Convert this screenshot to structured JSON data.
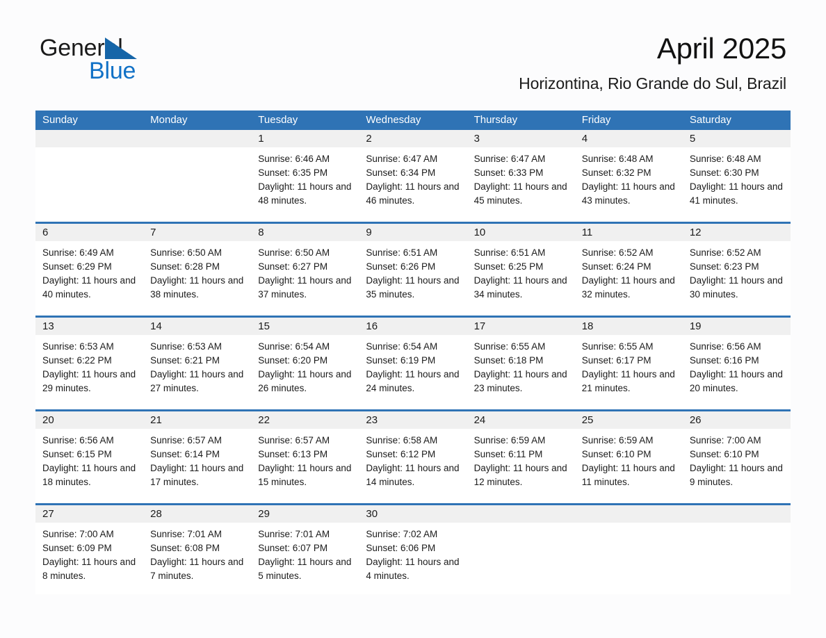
{
  "brand": {
    "name_part1": "General",
    "name_part2": "Blue",
    "triangle_icon": "brand-triangle-icon",
    "colors": {
      "blue": "#1171c6",
      "triangle_blue": "#1565a8",
      "black": "#1a1a1a"
    }
  },
  "header": {
    "month_title": "April 2025",
    "location": "Horizontina, Rio Grande do Sul, Brazil"
  },
  "theme": {
    "header_blue": "#2f73b5",
    "daynum_gray": "#f0f0f0",
    "page_background": "#fcfcfd",
    "text": "#1b1b1b"
  },
  "calendar": {
    "weekdays": [
      "Sunday",
      "Monday",
      "Tuesday",
      "Wednesday",
      "Thursday",
      "Friday",
      "Saturday"
    ],
    "weeks": [
      [
        {
          "day": "",
          "empty": true
        },
        {
          "day": "",
          "empty": true
        },
        {
          "day": "1",
          "sunrise": "Sunrise: 6:46 AM",
          "sunset": "Sunset: 6:35 PM",
          "daylight": "Daylight: 11 hours and 48 minutes."
        },
        {
          "day": "2",
          "sunrise": "Sunrise: 6:47 AM",
          "sunset": "Sunset: 6:34 PM",
          "daylight": "Daylight: 11 hours and 46 minutes."
        },
        {
          "day": "3",
          "sunrise": "Sunrise: 6:47 AM",
          "sunset": "Sunset: 6:33 PM",
          "daylight": "Daylight: 11 hours and 45 minutes."
        },
        {
          "day": "4",
          "sunrise": "Sunrise: 6:48 AM",
          "sunset": "Sunset: 6:32 PM",
          "daylight": "Daylight: 11 hours and 43 minutes."
        },
        {
          "day": "5",
          "sunrise": "Sunrise: 6:48 AM",
          "sunset": "Sunset: 6:30 PM",
          "daylight": "Daylight: 11 hours and 41 minutes."
        }
      ],
      [
        {
          "day": "6",
          "sunrise": "Sunrise: 6:49 AM",
          "sunset": "Sunset: 6:29 PM",
          "daylight": "Daylight: 11 hours and 40 minutes."
        },
        {
          "day": "7",
          "sunrise": "Sunrise: 6:50 AM",
          "sunset": "Sunset: 6:28 PM",
          "daylight": "Daylight: 11 hours and 38 minutes."
        },
        {
          "day": "8",
          "sunrise": "Sunrise: 6:50 AM",
          "sunset": "Sunset: 6:27 PM",
          "daylight": "Daylight: 11 hours and 37 minutes."
        },
        {
          "day": "9",
          "sunrise": "Sunrise: 6:51 AM",
          "sunset": "Sunset: 6:26 PM",
          "daylight": "Daylight: 11 hours and 35 minutes."
        },
        {
          "day": "10",
          "sunrise": "Sunrise: 6:51 AM",
          "sunset": "Sunset: 6:25 PM",
          "daylight": "Daylight: 11 hours and 34 minutes."
        },
        {
          "day": "11",
          "sunrise": "Sunrise: 6:52 AM",
          "sunset": "Sunset: 6:24 PM",
          "daylight": "Daylight: 11 hours and 32 minutes."
        },
        {
          "day": "12",
          "sunrise": "Sunrise: 6:52 AM",
          "sunset": "Sunset: 6:23 PM",
          "daylight": "Daylight: 11 hours and 30 minutes."
        }
      ],
      [
        {
          "day": "13",
          "sunrise": "Sunrise: 6:53 AM",
          "sunset": "Sunset: 6:22 PM",
          "daylight": "Daylight: 11 hours and 29 minutes."
        },
        {
          "day": "14",
          "sunrise": "Sunrise: 6:53 AM",
          "sunset": "Sunset: 6:21 PM",
          "daylight": "Daylight: 11 hours and 27 minutes."
        },
        {
          "day": "15",
          "sunrise": "Sunrise: 6:54 AM",
          "sunset": "Sunset: 6:20 PM",
          "daylight": "Daylight: 11 hours and 26 minutes."
        },
        {
          "day": "16",
          "sunrise": "Sunrise: 6:54 AM",
          "sunset": "Sunset: 6:19 PM",
          "daylight": "Daylight: 11 hours and 24 minutes."
        },
        {
          "day": "17",
          "sunrise": "Sunrise: 6:55 AM",
          "sunset": "Sunset: 6:18 PM",
          "daylight": "Daylight: 11 hours and 23 minutes."
        },
        {
          "day": "18",
          "sunrise": "Sunrise: 6:55 AM",
          "sunset": "Sunset: 6:17 PM",
          "daylight": "Daylight: 11 hours and 21 minutes."
        },
        {
          "day": "19",
          "sunrise": "Sunrise: 6:56 AM",
          "sunset": "Sunset: 6:16 PM",
          "daylight": "Daylight: 11 hours and 20 minutes."
        }
      ],
      [
        {
          "day": "20",
          "sunrise": "Sunrise: 6:56 AM",
          "sunset": "Sunset: 6:15 PM",
          "daylight": "Daylight: 11 hours and 18 minutes."
        },
        {
          "day": "21",
          "sunrise": "Sunrise: 6:57 AM",
          "sunset": "Sunset: 6:14 PM",
          "daylight": "Daylight: 11 hours and 17 minutes."
        },
        {
          "day": "22",
          "sunrise": "Sunrise: 6:57 AM",
          "sunset": "Sunset: 6:13 PM",
          "daylight": "Daylight: 11 hours and 15 minutes."
        },
        {
          "day": "23",
          "sunrise": "Sunrise: 6:58 AM",
          "sunset": "Sunset: 6:12 PM",
          "daylight": "Daylight: 11 hours and 14 minutes."
        },
        {
          "day": "24",
          "sunrise": "Sunrise: 6:59 AM",
          "sunset": "Sunset: 6:11 PM",
          "daylight": "Daylight: 11 hours and 12 minutes."
        },
        {
          "day": "25",
          "sunrise": "Sunrise: 6:59 AM",
          "sunset": "Sunset: 6:10 PM",
          "daylight": "Daylight: 11 hours and 11 minutes."
        },
        {
          "day": "26",
          "sunrise": "Sunrise: 7:00 AM",
          "sunset": "Sunset: 6:10 PM",
          "daylight": "Daylight: 11 hours and 9 minutes."
        }
      ],
      [
        {
          "day": "27",
          "sunrise": "Sunrise: 7:00 AM",
          "sunset": "Sunset: 6:09 PM",
          "daylight": "Daylight: 11 hours and 8 minutes."
        },
        {
          "day": "28",
          "sunrise": "Sunrise: 7:01 AM",
          "sunset": "Sunset: 6:08 PM",
          "daylight": "Daylight: 11 hours and 7 minutes."
        },
        {
          "day": "29",
          "sunrise": "Sunrise: 7:01 AM",
          "sunset": "Sunset: 6:07 PM",
          "daylight": "Daylight: 11 hours and 5 minutes."
        },
        {
          "day": "30",
          "sunrise": "Sunrise: 7:02 AM",
          "sunset": "Sunset: 6:06 PM",
          "daylight": "Daylight: 11 hours and 4 minutes."
        },
        {
          "day": "",
          "empty": true
        },
        {
          "day": "",
          "empty": true
        },
        {
          "day": "",
          "empty": true
        }
      ]
    ]
  }
}
